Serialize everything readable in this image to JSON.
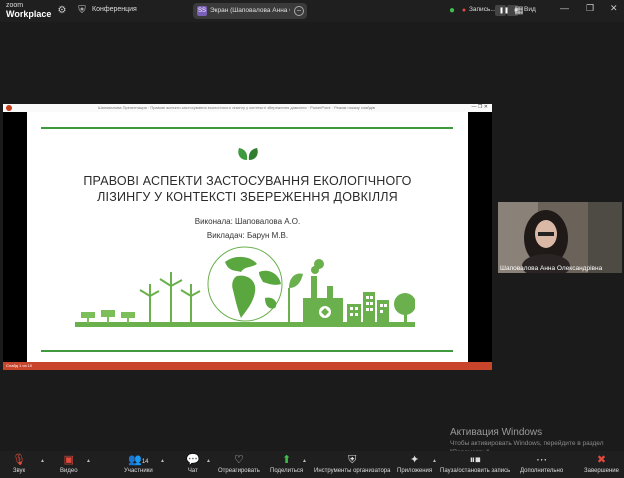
{
  "app": {
    "logo_line1": "zoom",
    "logo_line2": "Workplace"
  },
  "topbar": {
    "conference_label": "Конференция",
    "screen_share_label": "Экран (Шаповалова Анна Олек",
    "screen_share_badge": "SS",
    "recording_label": "Запись...",
    "view_label": "Вид"
  },
  "ppt": {
    "title_bar_text": "Шаповалова Презентация · Правові аспекти застосування екологічного лізингу у контексті збереження довкілля · PowerPoint · Режим показу слайдів",
    "status_text": "Слайд 1 из 10"
  },
  "slide": {
    "title_line1": "ПРАВОВІ АСПЕКТИ ЗАСТОСУВАННЯ ЕКОЛОГІЧНОГО",
    "title_line2": "ЛІЗИНГУ У КОНТЕКСТІ ЗБЕРЕЖЕННЯ ДОВКІЛЛЯ",
    "author": "Виконала: Шаповалова А.О.",
    "teacher": "Викладач: Барун М.В.",
    "accent_color": "#3f9a3f"
  },
  "participant": {
    "name": "Шаповалова Анна Олександрівна"
  },
  "watermark": {
    "title": "Активация Windows",
    "text": "Чтобы активировать Windows, перейдите в раздел \"Параметры\"."
  },
  "toolbar": {
    "audio": "Звук",
    "video": "Видео",
    "participants": "Участники",
    "participants_count": "14",
    "chat": "Чат",
    "react": "Отреагировать",
    "share": "Поделиться",
    "host_tools": "Инструменты организатора",
    "apps": "Приложения",
    "pause_rec": "Пауза/остановить запись",
    "more": "Дополнительно",
    "end": "Завершение"
  }
}
